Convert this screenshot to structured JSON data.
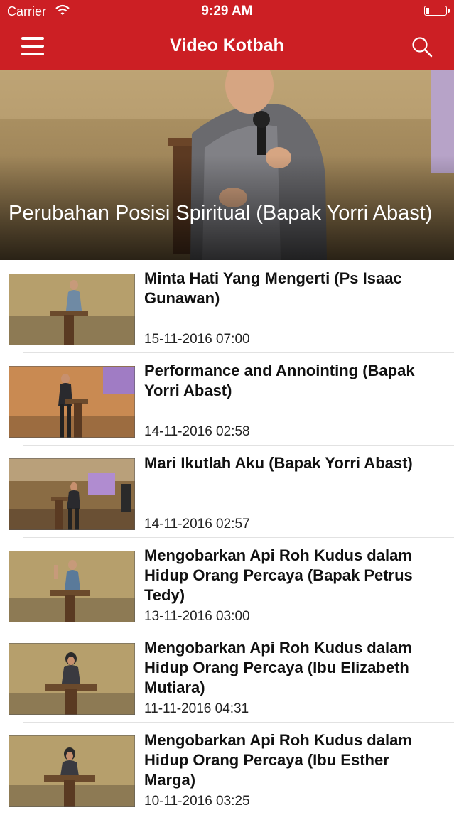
{
  "status_bar": {
    "carrier": "Carrier",
    "time": "9:29 AM"
  },
  "header": {
    "title": "Video Kotbah"
  },
  "featured": {
    "title": "Perubahan Posisi Spiritual (Bapak Yorri Abast)"
  },
  "videos": [
    {
      "title": "Minta Hati Yang Mengerti (Ps Isaac Gunawan)",
      "date": "15-11-2016 07:00"
    },
    {
      "title": "Performance and Annointing (Bapak Yorri Abast)",
      "date": "14-11-2016 02:58"
    },
    {
      "title": "Mari Ikutlah Aku (Bapak Yorri Abast)",
      "date": "14-11-2016 02:57"
    },
    {
      "title": "Mengobarkan Api Roh Kudus dalam Hidup Orang Percaya (Bapak Petrus Tedy)",
      "date": "13-11-2016 03:00"
    },
    {
      "title": "Mengobarkan Api Roh Kudus dalam Hidup Orang Percaya (Ibu Elizabeth Mutiara)",
      "date": "11-11-2016 04:31"
    },
    {
      "title": "Mengobarkan Api Roh Kudus dalam Hidup Orang Percaya (Ibu Esther Marga)",
      "date": "10-11-2016 03:25"
    }
  ],
  "colors": {
    "brand": "#cc1f24"
  }
}
